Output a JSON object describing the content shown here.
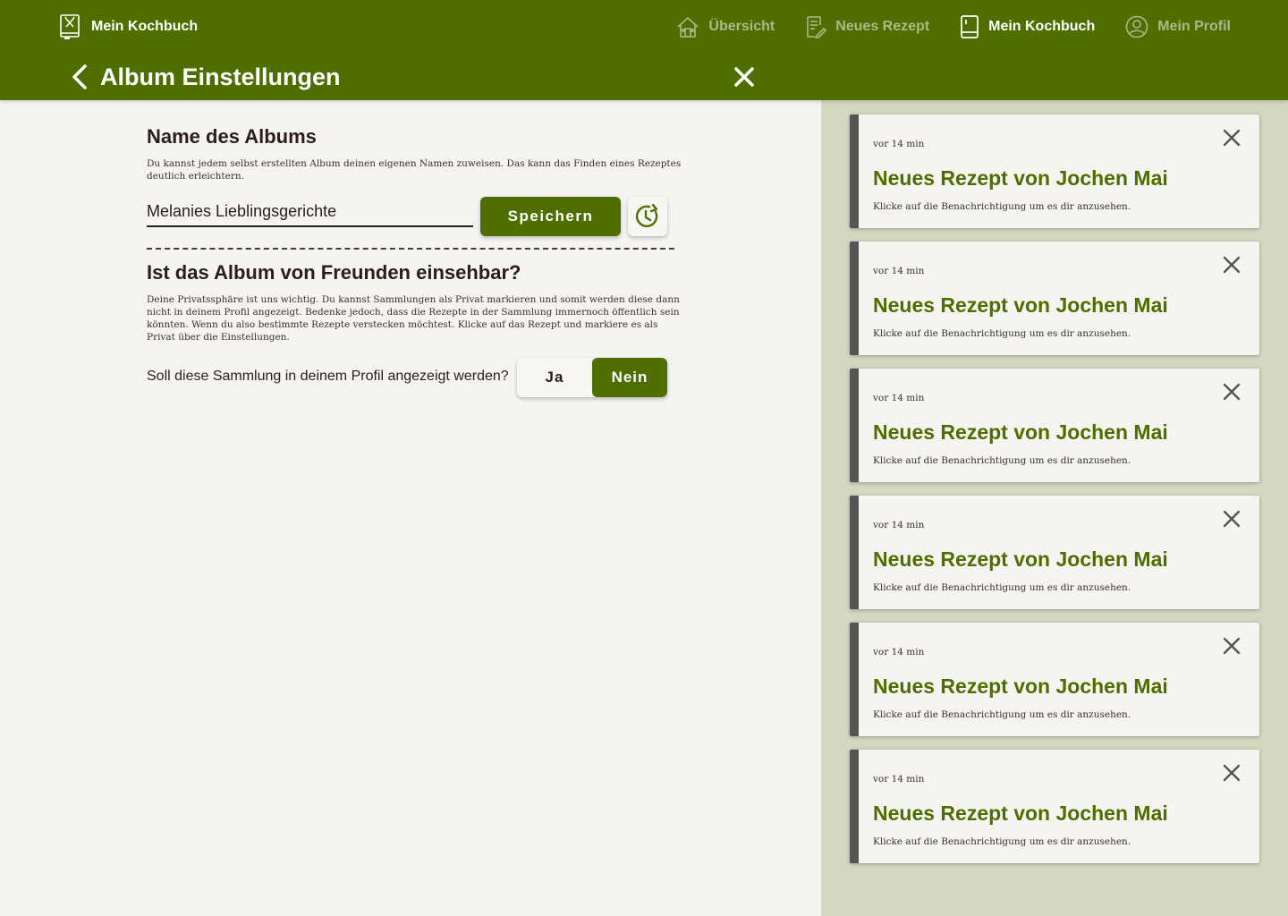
{
  "header": {
    "brand": "Mein Kochbuch",
    "page_title": "Album Einstellungen",
    "nav": [
      {
        "label": "Übersicht",
        "icon": "house-icon",
        "active": false
      },
      {
        "label": "Neues Rezept",
        "icon": "note-pencil-icon",
        "active": false
      },
      {
        "label": "Mein Kochbuch",
        "icon": "book-icon",
        "active": true
      },
      {
        "label": "Mein Profil",
        "icon": "user-circle-icon",
        "active": false
      }
    ]
  },
  "album_name": {
    "title": "Name des Albums",
    "description": "Du kannst jedem selbst erstellten Album deinen eigenen Namen zuweisen. Das kann das Finden eines Rezeptes deutlich erleichtern.",
    "value": "Melanies Lieblingsgerichte",
    "save_label": "Speichern"
  },
  "visibility": {
    "title": "Ist das Album von Freunden einsehbar?",
    "description": "Deine Privatssphäre ist uns wichtig. Du kannst Sammlungen als Privat markieren und somit werden diese dann nicht in deinem Profil angezeigt. Bedenke jedoch, dass die Rezepte in der Sammlung immernoch öffentlich sein könnten. Wenn du also bestimmte Rezepte verstecken möchtest. Klicke auf das Rezept und markiere es als Privat über die Einstellungen.",
    "question": "Soll diese Sammlung in deinem Profil angezeigt werden?",
    "option_yes": "Ja",
    "option_no": "Nein",
    "selected": "Nein"
  },
  "notifications": [
    {
      "time": "vor 14 min",
      "title": "Neues Rezept von Jochen Mai",
      "text": "Klicke auf die Benachrichtigung um es dir anzusehen."
    },
    {
      "time": "vor 14 min",
      "title": "Neues Rezept von Jochen Mai",
      "text": "Klicke auf die Benachrichtigung um es dir anzusehen."
    },
    {
      "time": "vor 14 min",
      "title": "Neues Rezept von Jochen Mai",
      "text": "Klicke auf die Benachrichtigung um es dir anzusehen."
    },
    {
      "time": "vor 14 min",
      "title": "Neues Rezept von Jochen Mai",
      "text": "Klicke auf die Benachrichtigung um es dir anzusehen."
    },
    {
      "time": "vor 14 min",
      "title": "Neues Rezept von Jochen Mai",
      "text": "Klicke auf die Benachrichtigung um es dir anzusehen."
    },
    {
      "time": "vor 14 min",
      "title": "Neues Rezept von Jochen Mai",
      "text": "Klicke auf die Benachrichtigung um es dir anzusehen."
    }
  ],
  "colors": {
    "brand_green": "#4e6f00",
    "panel_bg": "#d3d8c0",
    "page_bg": "#f5f4f0",
    "text_dark": "#2b1d1a"
  }
}
